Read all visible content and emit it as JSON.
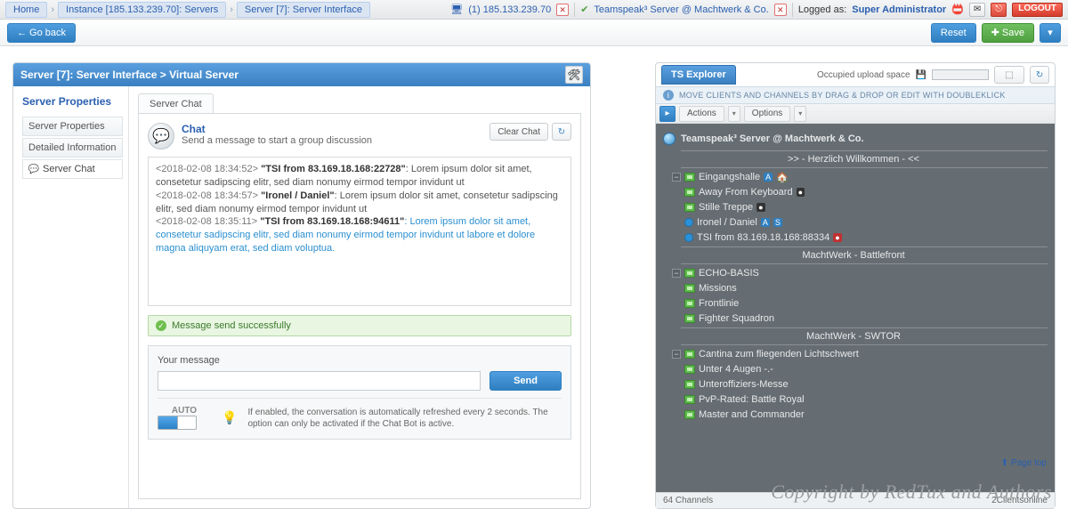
{
  "breadcrumb": {
    "home": "Home",
    "instance": "Instance [185.133.239.70]: Servers",
    "server": "Server [7]: Server Interface"
  },
  "topright": {
    "conn_label": "(1) 185.133.239.70",
    "ts_label": "Teamspeak³ Server @ Machtwerk & Co.",
    "logged_as": "Logged as:",
    "user": "Super Administrator",
    "logout": "LOGOUT"
  },
  "toolbar": {
    "goback": "← Go back",
    "reset": "Reset",
    "save": "✚ Save"
  },
  "panel_left": {
    "title": "Server [7]: Server Interface > Virtual Server",
    "sidebar": {
      "heading": "Server Properties",
      "items": [
        "Server Properties",
        "Detailed Information",
        "Server Chat"
      ]
    },
    "tab": "Server Chat",
    "chat": {
      "title": "Chat",
      "subtitle": "Send a message to start a group discussion",
      "clear": "Clear Chat",
      "log": [
        {
          "ts": "<2018-02-08 18:34:52>",
          "who": "\"TSI from 83.169.18.168:22728\"",
          "msg": ": Lorem ipsum dolor sit amet, consetetur sadipscing elitr, sed diam nonumy eirmod tempor invidunt ut",
          "hl": false
        },
        {
          "ts": "<2018-02-08 18:34:57>",
          "who": "\"Ironel / Daniel\"",
          "msg": ": Lorem ipsum dolor sit amet, consetetur sadipscing elitr, sed diam nonumy eirmod tempor invidunt ut",
          "hl": false
        },
        {
          "ts": "<2018-02-08 18:35:11>",
          "who": "\"TSI from 83.169.18.168:94611\"",
          "msg": ": Lorem ipsum dolor sit amet, consetetur sadipscing elitr, sed diam nonumy eirmod tempor invidunt ut labore et dolore magna aliquyam erat, sed diam voluptua.",
          "hl": true
        }
      ],
      "notice": "Message send successfully",
      "your_message": "Your message",
      "send": "Send",
      "auto_label": "AUTO",
      "auto_desc": "If enabled, the conversation is automatically refreshed every 2 seconds. The option can only be activated if the Chat Bot is active."
    }
  },
  "panel_right": {
    "title": "TS Explorer",
    "upload_label": "Occupied upload space",
    "info": "MOVE CLIENTS AND CHANNELS BY DRAG & DROP OR EDIT WITH DOUBLEKLICK",
    "actions": "Actions",
    "options": "Options",
    "root": "Teamspeak³ Server @ Machtwerk & Co.",
    "spacer_welcome": ">> - Herzlich Willkommen - <<",
    "spacer_battlefront": "MachtWerk - Battlefront",
    "spacer_swtor": "MachtWerk - SWTOR",
    "tree": {
      "eingangshalle": "Eingangshalle",
      "afk": "Away From Keyboard",
      "stille": "Stille Treppe",
      "ironel": "Ironel / Daniel",
      "tsi": "TSI from 83.169.18.168:88334",
      "echo": "ECHO-BASIS",
      "missions": "Missions",
      "frontlinie": "Frontlinie",
      "fighter": "Fighter Squadron",
      "cantina": "Cantina zum fliegenden Lichtschwert",
      "unter4": "Unter 4 Augen -.-",
      "unteroff": "Unteroffiziers-Messe",
      "pvp": "PvP-Rated: Battle Royal",
      "master": "Master and Commander"
    },
    "footer_left": "64 Channels",
    "footer_right": "2Clientsonline"
  },
  "pagetop": "Page top",
  "copyright": "Copyright by RedTux and Authors"
}
